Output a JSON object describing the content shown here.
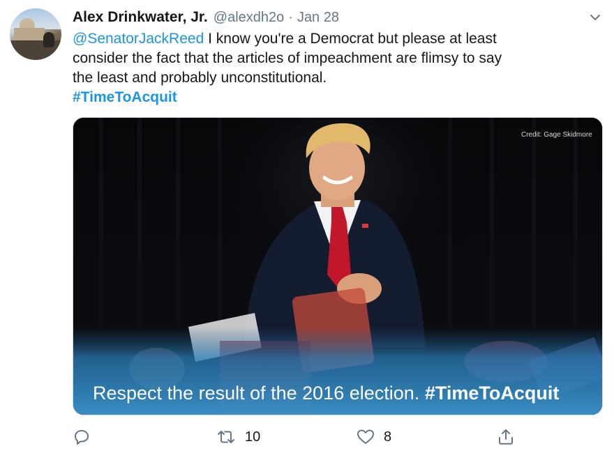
{
  "tweet": {
    "author_name": "Alex Drinkwater, Jr.",
    "author_handle": "@alexdh2o",
    "separator": "·",
    "date": "Jan 28",
    "mention": "@SenatorJackReed",
    "text_line1_rest": " I know you're a Democrat but please at least",
    "text_line2": "consider the fact that the articles of impeachment are  flimsy to say",
    "text_line3": "the least and probably unconstitutional.",
    "hashtag": "#TimeToAcquit"
  },
  "media": {
    "credit": "Credit: Gage Skidmore",
    "caption_text": "Respect the result of the 2016 election.",
    "caption_hashtag": "#TimeToAcquit"
  },
  "actions": {
    "reply_icon": "reply-icon",
    "retweet_icon": "retweet-icon",
    "retweet_count": "10",
    "like_icon": "heart-icon",
    "like_count": "8",
    "share_icon": "share-icon"
  },
  "colors": {
    "link": "#1b95e0",
    "secondary_text": "#657786",
    "primary_text": "#14171a"
  }
}
